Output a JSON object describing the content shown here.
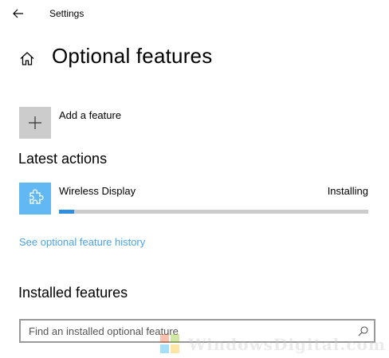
{
  "window": {
    "title": "Settings"
  },
  "header": {
    "title": "Optional features"
  },
  "add_feature": {
    "label": "Add a feature"
  },
  "latest_actions": {
    "heading": "Latest actions",
    "items": [
      {
        "name": "Wireless Display",
        "status": "Installing",
        "progress_percent": 5,
        "icon": "puzzle-piece-icon"
      }
    ]
  },
  "history_link": {
    "label": "See optional feature history"
  },
  "installed": {
    "heading": "Installed features",
    "search_placeholder": "Find an installed optional feature"
  },
  "watermark": {
    "text": "WindowsDigital.com"
  },
  "colors": {
    "accent_link": "#4aa3e8",
    "progress_fill": "#2f8ee0",
    "progress_track": "#cccccc",
    "feature_tile": "#62b8f3",
    "add_tile": "#cccccc"
  },
  "icons": {
    "back": "back-arrow-icon",
    "home": "home-icon",
    "add": "plus-icon",
    "search": "search-icon"
  }
}
